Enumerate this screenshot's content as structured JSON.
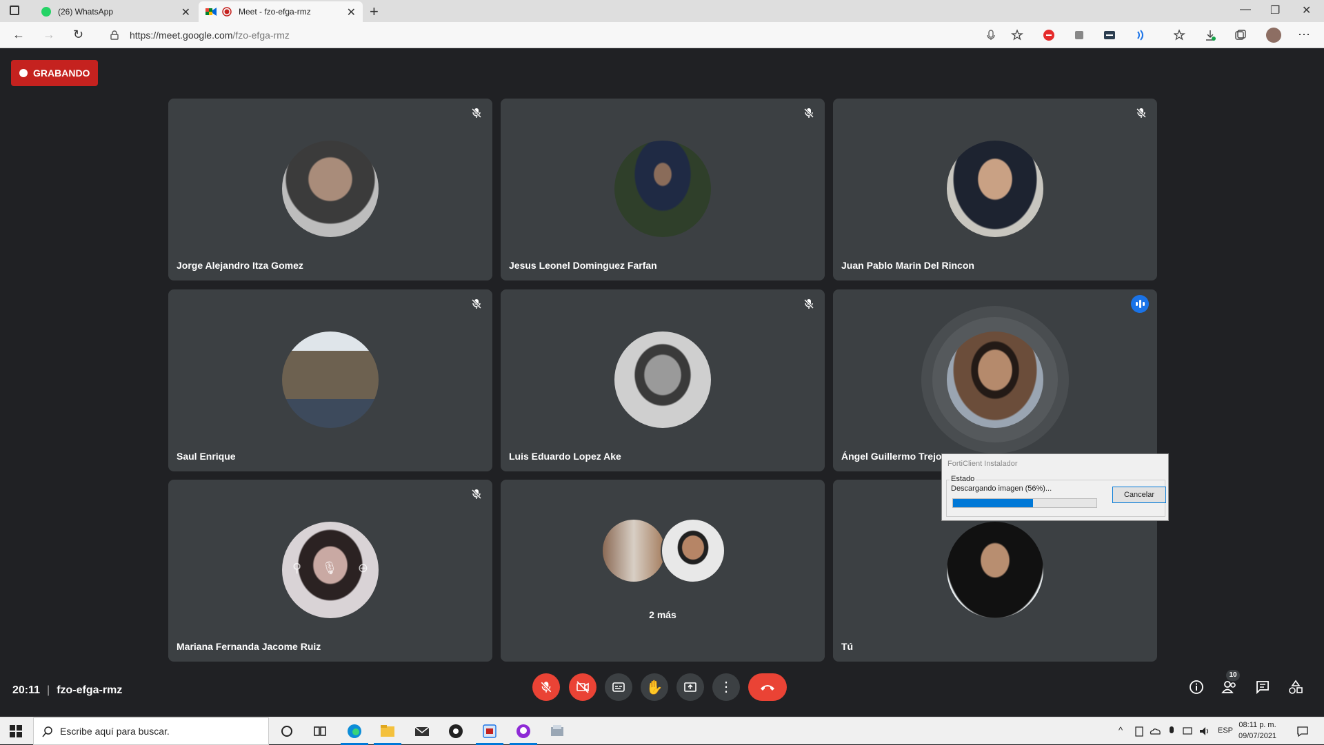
{
  "browser": {
    "tabs": [
      {
        "title": "(26) WhatsApp",
        "badge": "26"
      },
      {
        "title": "Meet - fzo-efga-rmz"
      }
    ],
    "url_host": "https://meet.google.com",
    "url_path": "/fzo-efga-rmz"
  },
  "meet": {
    "recording_label": "GRABANDO",
    "participants": [
      {
        "name": "Jorge Alejandro Itza Gomez",
        "muted": true
      },
      {
        "name": "Jesus Leonel Dominguez Farfan",
        "muted": true
      },
      {
        "name": "Juan Pablo Marin Del Rincon",
        "muted": true
      },
      {
        "name": "Saul Enrique",
        "muted": true
      },
      {
        "name": "Luis Eduardo Lopez Ake",
        "muted": true
      },
      {
        "name": "Ángel Guillermo Trejo",
        "muted": false,
        "speaking": true
      },
      {
        "name": "Mariana Fernanda Jacome Ruiz",
        "muted": true
      },
      {
        "name": "2 más",
        "group": true
      },
      {
        "name": "Tú",
        "muted": true
      }
    ],
    "time": "20:11",
    "meeting_code": "fzo-efga-rmz",
    "people_count": "10",
    "colors": {
      "accent": "#1a73e8",
      "danger": "#ea4335",
      "tile": "#3c4043",
      "background": "#202124"
    }
  },
  "dialog": {
    "title": "FortiClient Instalador",
    "group_label": "Estado",
    "status": "Descargando imagen (56%)...",
    "progress": 0.56,
    "cancel_label": "Cancelar"
  },
  "taskbar": {
    "search_placeholder": "Escribe aquí para buscar.",
    "language": "ESP",
    "clock_time": "08:11 p. m.",
    "clock_date": "09/07/2021"
  }
}
